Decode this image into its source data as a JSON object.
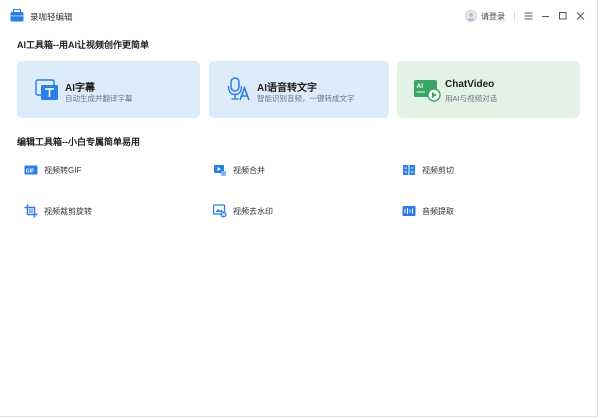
{
  "app": {
    "title": "录咖轻编辑"
  },
  "header": {
    "login_label": "请登录"
  },
  "sections": {
    "ai_title": "AI工具箱--用AI让视频创作更简单",
    "edit_title": "编辑工具箱--小白专属简单易用"
  },
  "ai_cards": [
    {
      "title": "AI字幕",
      "subtitle": "自动生成并翻译字幕",
      "icon": "subtitle-icon"
    },
    {
      "title": "AI语音转文字",
      "subtitle": "智能识别音频，一键转成文字",
      "icon": "speech-to-text-icon"
    },
    {
      "title": "ChatVideo",
      "subtitle": "用AI与视频对话",
      "icon": "chat-video-icon",
      "icon_text": "AI"
    }
  ],
  "tools": [
    {
      "label": "视频转GIF",
      "icon": "gif-icon",
      "icon_text": "GIF"
    },
    {
      "label": "视频合并",
      "icon": "video-merge-icon"
    },
    {
      "label": "视频剪切",
      "icon": "video-cut-icon"
    },
    {
      "label": "视频裁剪旋转",
      "icon": "crop-rotate-icon"
    },
    {
      "label": "视频去水印",
      "icon": "watermark-remove-icon"
    },
    {
      "label": "音频提取",
      "icon": "audio-extract-icon"
    }
  ],
  "colors": {
    "accent_blue": "#2b7de9",
    "card_blue": "#dcecfb",
    "card_green": "#e3f2e7",
    "green": "#3aa565"
  }
}
